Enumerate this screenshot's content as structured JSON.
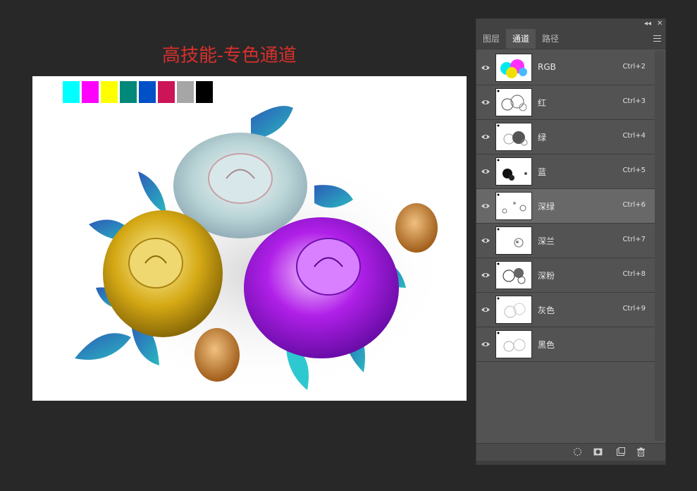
{
  "title": "高技能-专色通道",
  "swatches": [
    "#00ffff",
    "#ff00ff",
    "#ffff00",
    "#008878",
    "#0050c8",
    "#cc1458",
    "#a6a6a6",
    "#000000"
  ],
  "panel": {
    "tabs": [
      {
        "label": "图层",
        "active": false
      },
      {
        "label": "通道",
        "active": true
      },
      {
        "label": "路径",
        "active": false
      }
    ],
    "channels": [
      {
        "name": "RGB",
        "shortcut": "Ctrl+2",
        "selected": false
      },
      {
        "name": "红",
        "shortcut": "Ctrl+3",
        "selected": false
      },
      {
        "name": "绿",
        "shortcut": "Ctrl+4",
        "selected": false
      },
      {
        "name": "蓝",
        "shortcut": "Ctrl+5",
        "selected": false
      },
      {
        "name": "深绿",
        "shortcut": "Ctrl+6",
        "selected": true
      },
      {
        "name": "深兰",
        "shortcut": "Ctrl+7",
        "selected": false
      },
      {
        "name": "深粉",
        "shortcut": "Ctrl+8",
        "selected": false
      },
      {
        "name": "灰色",
        "shortcut": "Ctrl+9",
        "selected": false
      },
      {
        "name": "黑色",
        "shortcut": "",
        "selected": false
      }
    ],
    "footer_icons": [
      "load-selection-icon",
      "save-selection-icon",
      "new-channel-icon",
      "delete-channel-icon"
    ]
  }
}
